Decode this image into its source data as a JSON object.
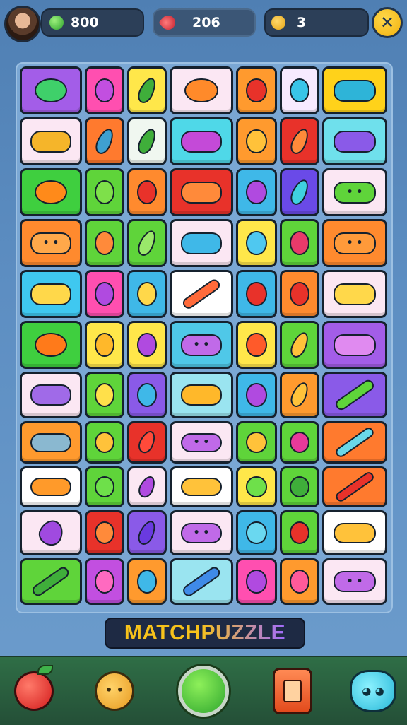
{
  "header": {
    "coins": "800",
    "gems": "206",
    "lives": "3",
    "close_symbol": "✕"
  },
  "title": {
    "part1": "MATCH ",
    "part2": "PUZZLE"
  },
  "board": {
    "rows": [
      [
        {
          "bg": "#a35de8",
          "icon": "star-icon",
          "c": "#3fd06a",
          "s": "round"
        },
        {
          "bg": "#ff4fb0",
          "icon": "plum-icon",
          "c": "#c24fe0",
          "s": "round"
        },
        {
          "bg": "#ffe74a",
          "icon": "pepper-icon",
          "c": "#3fae3a",
          "s": "leaf"
        },
        {
          "bg": "#fbe7f3",
          "icon": "sun-icon",
          "c": "#ff8a2a",
          "s": "round"
        },
        {
          "bg": "#ff9a2e",
          "icon": "apple-icon",
          "c": "#e8322a",
          "s": "round"
        },
        {
          "bg": "#f7eaff",
          "icon": "flower-icon",
          "c": "#39c5e8",
          "s": "round"
        },
        {
          "bg": "#ffd21a",
          "icon": "pencil-case-icon",
          "c": "#2eb4d8",
          "s": "wide"
        }
      ],
      [
        {
          "bg": "#fbe7f3",
          "icon": "banana-icon",
          "c": "#f5b52a",
          "s": "wide"
        },
        {
          "bg": "#ff7a2e",
          "icon": "bottle-icon",
          "c": "#3fa0d0",
          "s": "leaf"
        },
        {
          "bg": "#f0f7f0",
          "icon": "leaf-icon",
          "c": "#3fae3a",
          "s": "leaf"
        },
        {
          "bg": "#4fd8e8",
          "icon": "gadget-icon",
          "c": "#c44ad8",
          "s": "wide"
        },
        {
          "bg": "#ff9a2e",
          "icon": "pear-icon",
          "c": "#ffc23a",
          "s": "round"
        },
        {
          "bg": "#e8322a",
          "icon": "pen-icon",
          "c": "#ff8a3a",
          "s": "leaf"
        },
        {
          "bg": "#6fe0ec",
          "icon": "ball-icon",
          "c": "#8a5ae8",
          "s": "wide"
        }
      ],
      [
        {
          "bg": "#3fcf3f",
          "icon": "orange-icon",
          "c": "#ff8a1a",
          "s": "round"
        },
        {
          "bg": "#5fd43a",
          "icon": "lime-icon",
          "c": "#7ee04a",
          "s": "round"
        },
        {
          "bg": "#ff8a2e",
          "icon": "apple-icon",
          "c": "#e8322a",
          "s": "round"
        },
        {
          "bg": "#e8322a",
          "icon": "fan-icon",
          "c": "#ff8a3a",
          "s": "wide"
        },
        {
          "bg": "#3fb8e8",
          "icon": "plum-icon",
          "c": "#b04ae0",
          "s": "round"
        },
        {
          "bg": "#6a4ae8",
          "icon": "pen-icon",
          "c": "#3fd0e0",
          "s": "leaf"
        },
        {
          "bg": "#fbe7f3",
          "icon": "slime-icon",
          "c": "#5fd43a",
          "s": "wide"
        }
      ],
      [
        {
          "bg": "#ff8a2e",
          "icon": "bear-face-icon",
          "c": "#ffa84a",
          "s": "wide"
        },
        {
          "bg": "#5fd43a",
          "icon": "heart-icon",
          "c": "#ff8a3a",
          "s": "round"
        },
        {
          "bg": "#5fd43a",
          "icon": "leaf-icon",
          "c": "#9ae86a",
          "s": "leaf"
        },
        {
          "bg": "#fbe7f3",
          "icon": "camera-icon",
          "c": "#3fb8e8",
          "s": "wide"
        },
        {
          "bg": "#ffe74a",
          "icon": "balloon-icon",
          "c": "#4fc8f0",
          "s": "round"
        },
        {
          "bg": "#5fd43a",
          "icon": "flower-icon",
          "c": "#e83a6a",
          "s": "round"
        },
        {
          "bg": "#ff8a2e",
          "icon": "bear-face-icon",
          "c": "#ff9a3a",
          "s": "wide"
        }
      ],
      [
        {
          "bg": "#3fc8f0",
          "icon": "ticket-icon",
          "c": "#ffd84a",
          "s": "wide"
        },
        {
          "bg": "#ff4fb0",
          "icon": "plum-icon",
          "c": "#b04ae0",
          "s": "round"
        },
        {
          "bg": "#3fb8e8",
          "icon": "lemon-icon",
          "c": "#ffd84a",
          "s": "round"
        },
        {
          "bg": "#ffffff",
          "icon": "pencil-icon",
          "c": "#ff6a3a",
          "s": "long"
        },
        {
          "bg": "#3fb8e8",
          "icon": "apple-icon",
          "c": "#e8322a",
          "s": "round"
        },
        {
          "bg": "#ff8a2e",
          "icon": "balloon-icon",
          "c": "#e8322a",
          "s": "round"
        },
        {
          "bg": "#fbe7f3",
          "icon": "radio-icon",
          "c": "#ffd84a",
          "s": "wide"
        }
      ],
      [
        {
          "bg": "#3fcf3f",
          "icon": "orange-icon",
          "c": "#ff7a1a",
          "s": "round"
        },
        {
          "bg": "#ffe74a",
          "icon": "orange-icon",
          "c": "#ffb82a",
          "s": "round"
        },
        {
          "bg": "#ffe74a",
          "icon": "flower-icon",
          "c": "#b04ae0",
          "s": "round"
        },
        {
          "bg": "#4fc8e8",
          "icon": "monster-icon",
          "c": "#c06ae8",
          "s": "wide"
        },
        {
          "bg": "#ffe74a",
          "icon": "apple-icon",
          "c": "#ff5a2a",
          "s": "round"
        },
        {
          "bg": "#5fd43a",
          "icon": "corn-icon",
          "c": "#ffc23a",
          "s": "leaf"
        },
        {
          "bg": "#a35de8",
          "icon": "box-icon",
          "c": "#e08af0",
          "s": "wide"
        }
      ],
      [
        {
          "bg": "#fbe7f3",
          "icon": "candy-icon",
          "c": "#a06ae8",
          "s": "wide"
        },
        {
          "bg": "#5fd43a",
          "icon": "lemon-icon",
          "c": "#ffe04a",
          "s": "round"
        },
        {
          "bg": "#8a5ae8",
          "icon": "plum-icon",
          "c": "#3fb8e8",
          "s": "round"
        },
        {
          "bg": "#9ae4f0",
          "icon": "croissant-icon",
          "c": "#ffb82a",
          "s": "wide"
        },
        {
          "bg": "#3fb8e8",
          "icon": "plum-icon",
          "c": "#b04ae0",
          "s": "round"
        },
        {
          "bg": "#ff9a2e",
          "icon": "corn-icon",
          "c": "#ffc23a",
          "s": "leaf"
        },
        {
          "bg": "#8a5ae8",
          "icon": "cucumber-icon",
          "c": "#5fd43a",
          "s": "long"
        }
      ],
      [
        {
          "bg": "#ff9a2e",
          "icon": "bandage-icon",
          "c": "#8ab8d0",
          "s": "wide"
        },
        {
          "bg": "#5fd43a",
          "icon": "pineapple-icon",
          "c": "#ffc23a",
          "s": "round"
        },
        {
          "bg": "#e8322a",
          "icon": "strawberry-icon",
          "c": "#ff4a3a",
          "s": "leaf"
        },
        {
          "bg": "#fbe7f3",
          "icon": "monster-icon",
          "c": "#c06ae8",
          "s": "wide"
        },
        {
          "bg": "#5fd43a",
          "icon": "pineapple-icon",
          "c": "#ffc23a",
          "s": "round"
        },
        {
          "bg": "#5fd43a",
          "icon": "radish-icon",
          "c": "#e83a9a",
          "s": "round"
        },
        {
          "bg": "#ff7a2e",
          "icon": "capsule-icon",
          "c": "#6ad8e8",
          "s": "long"
        }
      ],
      [
        {
          "bg": "#ffffff",
          "icon": "fish-icon",
          "c": "#ff9a2a",
          "s": "wide"
        },
        {
          "bg": "#5fd43a",
          "icon": "lime-icon",
          "c": "#6ee04a",
          "s": "round"
        },
        {
          "bg": "#fbe7f3",
          "icon": "leaf-icon",
          "c": "#b04ae0",
          "s": "leaf"
        },
        {
          "bg": "#ffffff",
          "icon": "shell-icon",
          "c": "#ffc23a",
          "s": "wide"
        },
        {
          "bg": "#ffe74a",
          "icon": "lime-icon",
          "c": "#6ee04a",
          "s": "round"
        },
        {
          "bg": "#5fd43a",
          "icon": "leaf-icon",
          "c": "#3fae3a",
          "s": "round"
        },
        {
          "bg": "#ff7a2e",
          "icon": "tool-icon",
          "c": "#e8322a",
          "s": "long"
        }
      ],
      [
        {
          "bg": "#fbe7f3",
          "icon": "eggplant-icon",
          "c": "#a04ae0",
          "s": "leaf"
        },
        {
          "bg": "#e8322a",
          "icon": "heart-icon",
          "c": "#ff8a3a",
          "s": "round"
        },
        {
          "bg": "#8a5ae8",
          "icon": "pepper-icon",
          "c": "#6a3ae0",
          "s": "leaf"
        },
        {
          "bg": "#fbe7f3",
          "icon": "monster-icon",
          "c": "#c06ae8",
          "s": "wide"
        },
        {
          "bg": "#3fb8e8",
          "icon": "balloon-icon",
          "c": "#6ad8f0",
          "s": "round"
        },
        {
          "bg": "#5fd43a",
          "icon": "apple-icon",
          "c": "#e8322a",
          "s": "round"
        },
        {
          "bg": "#ffffff",
          "icon": "fish-icon",
          "c": "#ffc23a",
          "s": "wide"
        }
      ],
      [
        {
          "bg": "#5fd43a",
          "icon": "crayon-icon",
          "c": "#3fae3a",
          "s": "long"
        },
        {
          "bg": "#c24fe0",
          "icon": "flower-icon",
          "c": "#ff6ac0",
          "s": "round"
        },
        {
          "bg": "#ff9a2e",
          "icon": "lime-icon",
          "c": "#3fb8e8",
          "s": "round"
        },
        {
          "bg": "#9ae4f0",
          "icon": "marker-icon",
          "c": "#3f8ae8",
          "s": "long"
        },
        {
          "bg": "#ff4fb0",
          "icon": "plum-icon",
          "c": "#b04ae0",
          "s": "round"
        },
        {
          "bg": "#ff9a2e",
          "icon": "lollipop-icon",
          "c": "#ff5a9a",
          "s": "round"
        },
        {
          "bg": "#fbe7f3",
          "icon": "monster-icon",
          "c": "#c06ae8",
          "s": "wide"
        }
      ]
    ]
  },
  "bottom_bar": {
    "items": [
      "apple-icon",
      "helper-icon",
      "go-button",
      "booster-icon",
      "mascot-icon"
    ]
  }
}
